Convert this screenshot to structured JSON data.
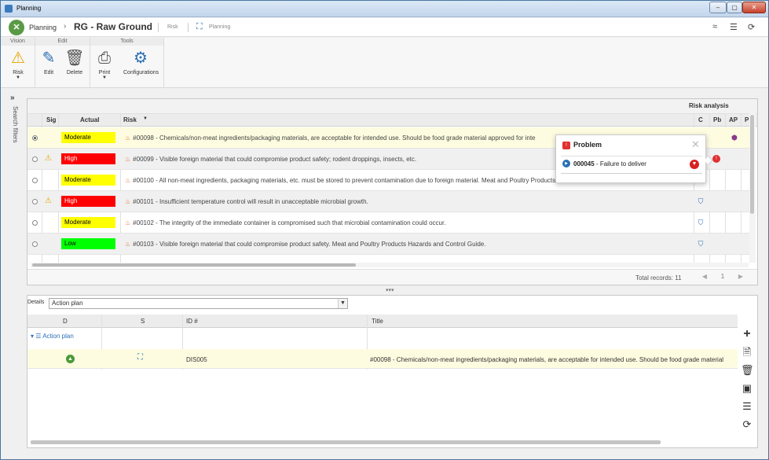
{
  "window": {
    "title": "Planning",
    "min": "–",
    "max": "▢",
    "close": "✕"
  },
  "header": {
    "module": "Planning",
    "record": "RG - Raw Ground",
    "link_risk": "Risk",
    "link_planning": "Planning"
  },
  "ribbon": {
    "groups": [
      {
        "label": "Vision"
      },
      {
        "label": "Edit"
      },
      {
        "label": "Tools"
      }
    ],
    "buttons": {
      "risk": "Risk",
      "edit": "Edit",
      "delete": "Delete",
      "print": "Print",
      "configurations": "Configurations"
    }
  },
  "side": {
    "label": "Search filters"
  },
  "grid": {
    "group_header": "Risk analysis",
    "columns": {
      "sig": "Sig",
      "actual": "Actual",
      "risk": "Risk",
      "c": "C",
      "pb": "Pb",
      "ap": "AP",
      "p": "P"
    },
    "rows": [
      {
        "level": "Moderate",
        "class": "moderate",
        "warn": false,
        "selected": true,
        "text": "#00098 - Chemicals/non-meat ingredients/packaging materials, are acceptable for intended use. Should be food grade material approved for inte"
      },
      {
        "level": "High",
        "class": "high",
        "warn": true,
        "selected": false,
        "text": "#00099 - Visible foreign material that could compromise product safety; rodent droppings, insects, etc."
      },
      {
        "level": "Moderate",
        "class": "moderate",
        "warn": false,
        "selected": false,
        "text": "#00100 - All non-meat ingredients, packaging materials, etc. must be stored to prevent contamination due to foreign material. Meat and Poultry Products Hazards and Control Guide."
      },
      {
        "level": "High",
        "class": "high",
        "warn": true,
        "selected": false,
        "text": "#00101 - Insufficient temperature control will result in unacceptable microbial growth."
      },
      {
        "level": "Moderate",
        "class": "moderate",
        "warn": false,
        "selected": false,
        "text": "#00102 - The integrity of the immediate container is compromised such that microbial contamination could occur."
      },
      {
        "level": "Low",
        "class": "low",
        "warn": false,
        "selected": false,
        "text": "#00103 - Visible foreign material that could compromise product safety. Meat and Poultry Products Hazards and Control Guide."
      }
    ],
    "total_records": "Total records: 11",
    "page": "1"
  },
  "popup": {
    "title": "Problem",
    "item_id": "000045",
    "item_text": " - Failure to deliver"
  },
  "details": {
    "label": "Details",
    "select_value": "Action plan",
    "columns": {
      "d": "D",
      "s": "S",
      "id": "ID #",
      "title": "Title"
    },
    "group": "Action plan",
    "row": {
      "id": "DIS005",
      "title": "#00098 - Chemicals/non-meat ingredients/packaging materials, are acceptable for intended use. Should be food grade material"
    }
  },
  "colors": {
    "moderate": "#ffff00",
    "high": "#ff0000",
    "low": "#00ff00",
    "accent": "#2a6fb5"
  }
}
